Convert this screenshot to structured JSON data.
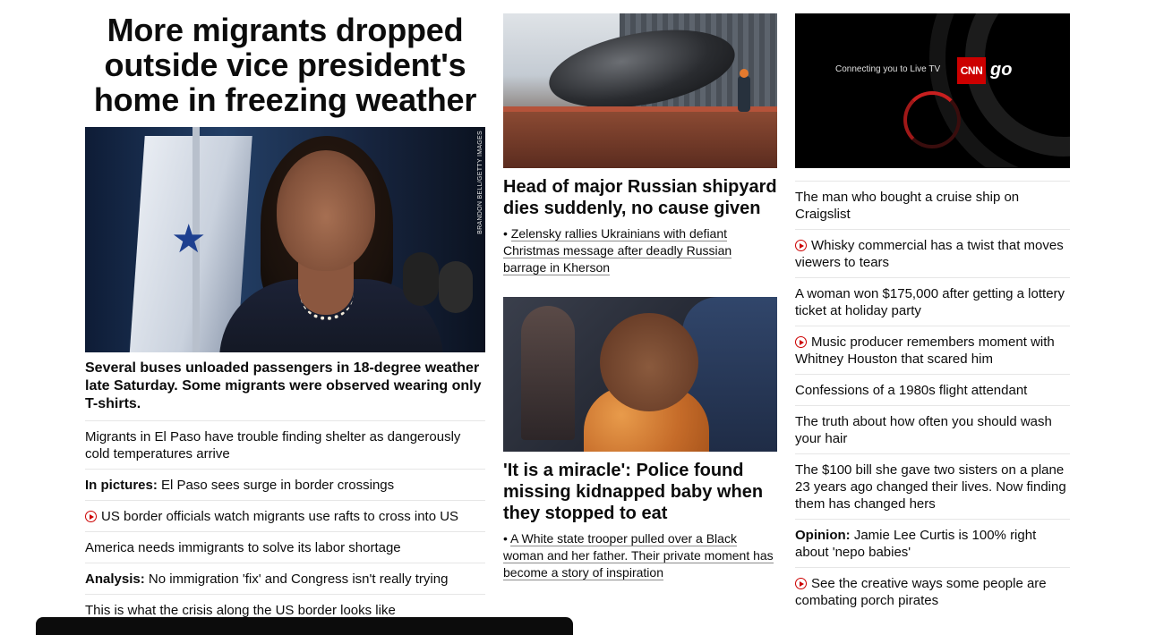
{
  "lead": {
    "headline": "More migrants dropped outside vice president's home in freezing weather",
    "image_credit": "BRANDON BELL/GETTY IMAGES",
    "caption": "Several buses unloaded passengers in 18-degree weather late Saturday. Some migrants were observed wearing only T-shirts.",
    "related": [
      {
        "prefix": "",
        "text": "Migrants in El Paso have trouble finding shelter as dangerously cold temperatures arrive",
        "video": false
      },
      {
        "prefix": "In pictures:",
        "text": " El Paso sees surge in border crossings",
        "video": false
      },
      {
        "prefix": "",
        "text": "US border officials watch migrants use rafts to cross into US",
        "video": true
      },
      {
        "prefix": "",
        "text": "America needs immigrants to solve its labor shortage",
        "video": false
      },
      {
        "prefix": "Analysis:",
        "text": " No immigration 'fix' and Congress isn't really trying",
        "video": false
      },
      {
        "prefix": "",
        "text": "This is what the crisis along the US border looks like",
        "video": false
      }
    ]
  },
  "middle": {
    "story1": {
      "title": "Head of major Russian shipyard dies suddenly, no cause given",
      "sub": "Zelensky rallies Ukrainians with defiant Christmas message after deadly Russian barrage in Kherson"
    },
    "story2": {
      "title": "'It is a miracle': Police found missing kidnapped baby when they stopped to eat",
      "sub": "A White state trooper pulled over a Black woman and her father. Their private moment has become a story of inspiration"
    }
  },
  "right": {
    "player": {
      "live_text": "Connecting you to Live TV",
      "logo_text": "CNN",
      "go_text": "go"
    },
    "list": [
      {
        "prefix": "",
        "text": "The man who bought a cruise ship on Craigslist",
        "video": false
      },
      {
        "prefix": "",
        "text": "Whisky commercial has a twist that moves viewers to tears",
        "video": true
      },
      {
        "prefix": "",
        "text": "A woman won $175,000 after getting a lottery ticket at holiday party",
        "video": false
      },
      {
        "prefix": "",
        "text": "Music producer remembers moment with Whitney Houston that scared him",
        "video": true
      },
      {
        "prefix": "",
        "text": "Confessions of a 1980s flight attendant",
        "video": false
      },
      {
        "prefix": "",
        "text": "The truth about how often you should wash your hair",
        "video": false
      },
      {
        "prefix": "",
        "text": "The $100 bill she gave two sisters on a plane 23 years ago changed their lives. Now finding them has changed hers",
        "video": false
      },
      {
        "prefix": "Opinion:",
        "text": " Jamie Lee Curtis is 100% right about 'nepo babies'",
        "video": false
      },
      {
        "prefix": "",
        "text": "See the creative ways some people are combating porch pirates",
        "video": true
      }
    ]
  },
  "colors": {
    "accent": "#cc0000",
    "text": "#0c0c0c",
    "divider": "#e6e6e6"
  }
}
